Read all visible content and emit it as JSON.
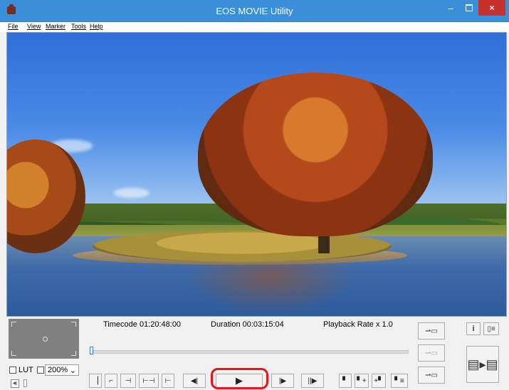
{
  "window": {
    "title": "EOS MOVIE Utility",
    "close_glyph": "×",
    "minimize_glyph": "–"
  },
  "menu": {
    "file": "File",
    "view": "View",
    "marker": "Marker",
    "tools": "Tools",
    "help": "Help"
  },
  "info": {
    "timecode": "Timecode 01:20:48:00",
    "duration": "Duration 00:03:15:04",
    "playback_rate": "Playback Rate x 1.0"
  },
  "lut": {
    "label": "LUT"
  },
  "zoom": {
    "value": "200%",
    "caret": "⌄"
  },
  "icons": {
    "volume": "speaker-icon",
    "play": "play-icon",
    "info_glyph": "i"
  },
  "colors": {
    "titlebar": "#3b8fd8",
    "close": "#c7312b",
    "play_highlight": "#e8141c"
  }
}
